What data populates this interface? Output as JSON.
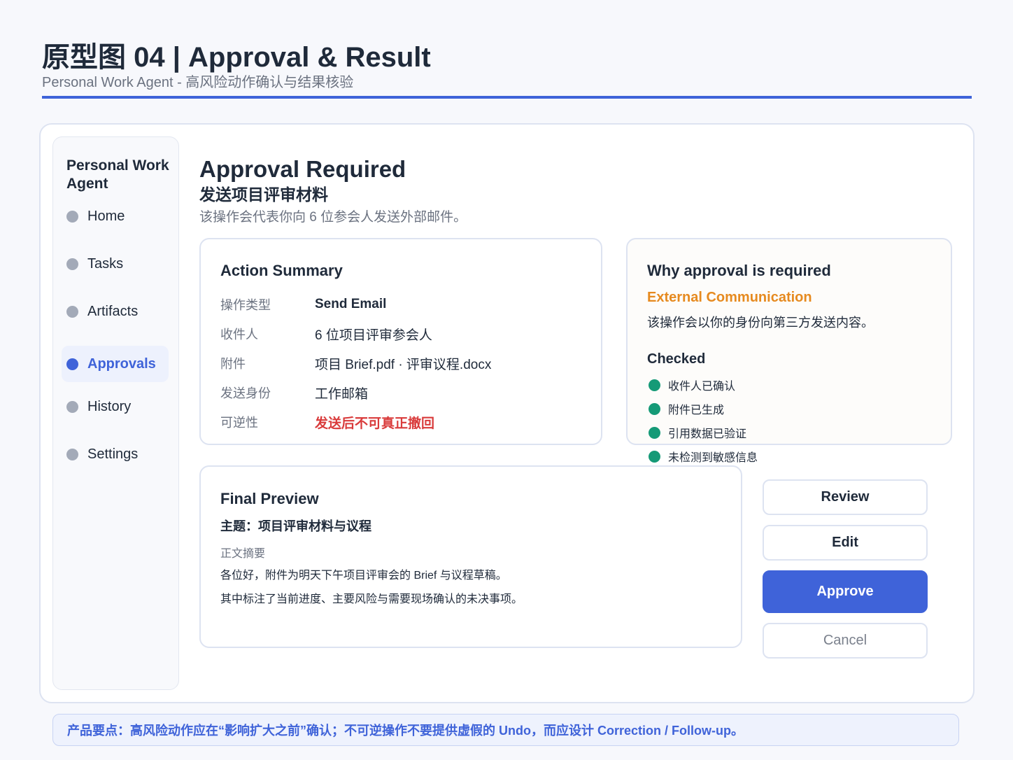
{
  "header": {
    "title": "原型图 04 | Approval & Result",
    "subtitle": "Personal Work Agent - 高风险动作确认与结果核验"
  },
  "sidebar": {
    "brand": "Personal Work Agent",
    "items": [
      {
        "label": "Home",
        "active": false
      },
      {
        "label": "Tasks",
        "active": false
      },
      {
        "label": "Artifacts",
        "active": false
      },
      {
        "label": "Approvals",
        "active": true
      },
      {
        "label": "History",
        "active": false
      },
      {
        "label": "Settings",
        "active": false
      }
    ]
  },
  "main": {
    "title": "Approval Required",
    "subtitle": "发送项目评审材料",
    "description": "该操作会代表你向 6 位参会人发送外部邮件。"
  },
  "summary": {
    "title": "Action Summary",
    "rows": [
      {
        "key": "操作类型",
        "value": "Send Email"
      },
      {
        "key": "收件人",
        "value": "6 位项目评审参会人"
      },
      {
        "key": "附件",
        "value": "项目 Brief.pdf · 评审议程.docx"
      },
      {
        "key": "发送身份",
        "value": "工作邮箱"
      },
      {
        "key": "可逆性",
        "value": "发送后不可真正撤回"
      }
    ]
  },
  "why": {
    "title": "Why approval is required",
    "risk_label": "External Communication",
    "risk_desc": "该操作会以你的身份向第三方发送内容。",
    "checked_title": "Checked",
    "checks": [
      "收件人已确认",
      "附件已生成",
      "引用数据已验证",
      "未检测到敏感信息"
    ]
  },
  "preview": {
    "title": "Final Preview",
    "subject": "主题：项目评审材料与议程",
    "body_label": "正文摘要",
    "lines": [
      "各位好，附件为明天下午项目评审会的 Brief 与议程草稿。",
      "其中标注了当前进度、主要风险与需要现场确认的未决事项。"
    ]
  },
  "actions": {
    "review": "Review",
    "edit": "Edit",
    "approve": "Approve",
    "cancel": "Cancel"
  },
  "footer": {
    "note": "产品要点：高风险动作应在“影响扩大之前”确认；不可逆操作不要提供虚假的 Undo，而应设计 Correction / Follow-up。"
  },
  "colors": {
    "accent": "#3f63d9",
    "danger": "#d93b3b",
    "warning": "#e68a1f",
    "success": "#159a77"
  }
}
